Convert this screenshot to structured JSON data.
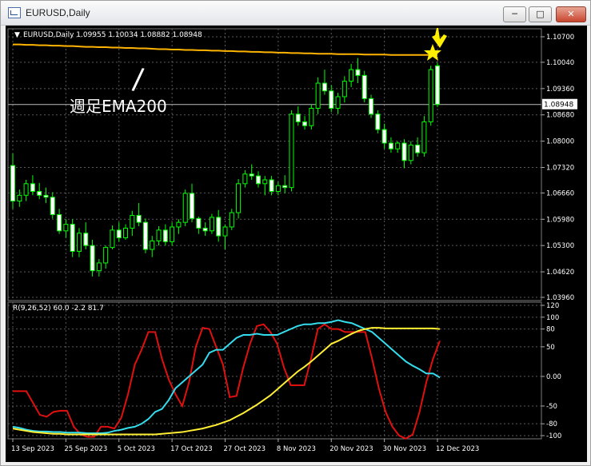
{
  "window": {
    "title": "EURUSD,Daily",
    "minimize_icon": "minimize-icon",
    "maximize_icon": "maximize-icon",
    "close_icon": "close-icon"
  },
  "colors": {
    "background": "#000000",
    "grid": "#5a5a5a",
    "candle_up": "#00ff00",
    "candle_down_body": "#ffffff",
    "ema": "#ffb400",
    "macd": "#e01010",
    "signal_cyan": "#33ddee",
    "signal_yellow": "#ffee33",
    "marker": "#ffee00",
    "annotation": "#ffffff"
  },
  "chart_data": [
    {
      "type": "candlestick",
      "title": "EURUSD,Daily  1.09955 1.10034 1.08882 1.08948",
      "symbol": "EURUSD",
      "timeframe": "Daily",
      "last_bar": {
        "open": 1.09955,
        "high": 1.10034,
        "low": 1.08882,
        "close": 1.08948
      },
      "current_price_label": "1.08948",
      "ylim": [
        1.0396,
        1.107
      ],
      "y_ticks": [
        "1.10700",
        "1.10040",
        "1.09360",
        "1.08680",
        "1.08000",
        "1.07320",
        "1.06660",
        "1.05980",
        "1.05300",
        "1.04620",
        "1.03960"
      ],
      "x_ticks": [
        "13 Sep 2023",
        "25 Sep 2023",
        "5 Oct 2023",
        "17 Oct 2023",
        "27 Oct 2023",
        "8 Nov 2023",
        "20 Nov 2023",
        "30 Nov 2023",
        "12 Dec 2023"
      ],
      "candles": [
        [
          1.0737,
          1.0768,
          1.0625,
          1.0645
        ],
        [
          1.0645,
          1.0675,
          1.063,
          1.066
        ],
        [
          1.066,
          1.07,
          1.0645,
          1.069
        ],
        [
          1.069,
          1.0712,
          1.066,
          1.067
        ],
        [
          1.067,
          1.0692,
          1.065,
          1.066
        ],
        [
          1.066,
          1.068,
          1.064,
          1.0655
        ],
        [
          1.0655,
          1.0668,
          1.06,
          1.061
        ],
        [
          1.061,
          1.0625,
          1.056,
          1.0568
        ],
        [
          1.0568,
          1.0598,
          1.055,
          1.0585
        ],
        [
          1.0585,
          1.0598,
          1.05,
          1.0515
        ],
        [
          1.0515,
          1.0575,
          1.05,
          1.0562
        ],
        [
          1.0562,
          1.059,
          1.052,
          1.053
        ],
        [
          1.053,
          1.0545,
          1.045,
          1.0465
        ],
        [
          1.0465,
          1.0495,
          1.045,
          1.0485
        ],
        [
          1.0485,
          1.053,
          1.047,
          1.0525
        ],
        [
          1.0525,
          1.0582,
          1.052,
          1.057
        ],
        [
          1.057,
          1.059,
          1.054,
          1.055
        ],
        [
          1.055,
          1.0585,
          1.0545,
          1.0575
        ],
        [
          1.0575,
          1.062,
          1.0555,
          1.0608
        ],
        [
          1.0608,
          1.064,
          1.058,
          1.059
        ],
        [
          1.059,
          1.06,
          1.051,
          1.052
        ],
        [
          1.052,
          1.0555,
          1.05,
          1.0542
        ],
        [
          1.0542,
          1.058,
          1.053,
          1.057
        ],
        [
          1.057,
          1.0585,
          1.053,
          1.054
        ],
        [
          1.054,
          1.059,
          1.053,
          1.0578
        ],
        [
          1.0578,
          1.0598,
          1.056,
          1.059
        ],
        [
          1.059,
          1.0675,
          1.058,
          1.0665
        ],
        [
          1.0665,
          1.069,
          1.059,
          1.06
        ],
        [
          1.06,
          1.0605,
          1.056,
          1.0575
        ],
        [
          1.0575,
          1.059,
          1.0555,
          1.0568
        ],
        [
          1.0568,
          1.0612,
          1.056,
          1.0603
        ],
        [
          1.0603,
          1.0622,
          1.054,
          1.0555
        ],
        [
          1.0555,
          1.0585,
          1.052,
          1.0578
        ],
        [
          1.0578,
          1.0625,
          1.057,
          1.0615
        ],
        [
          1.0615,
          1.0702,
          1.06,
          1.069
        ],
        [
          1.069,
          1.0725,
          1.068,
          1.0715
        ],
        [
          1.0715,
          1.074,
          1.07,
          1.071
        ],
        [
          1.071,
          1.0722,
          1.068,
          1.069
        ],
        [
          1.069,
          1.071,
          1.066,
          1.07
        ],
        [
          1.07,
          1.071,
          1.066,
          1.067
        ],
        [
          1.067,
          1.0695,
          1.066,
          1.0685
        ],
        [
          1.0685,
          1.0712,
          1.0665,
          1.068
        ],
        [
          1.068,
          1.088,
          1.067,
          1.087
        ],
        [
          1.087,
          1.089,
          1.084,
          1.085
        ],
        [
          1.085,
          1.0865,
          1.083,
          1.084
        ],
        [
          1.084,
          1.0895,
          1.083,
          1.0885
        ],
        [
          1.0885,
          1.0965,
          1.087,
          1.095
        ],
        [
          1.095,
          1.0985,
          1.092,
          1.093
        ],
        [
          1.093,
          1.0945,
          1.0875,
          1.0885
        ],
        [
          1.0885,
          1.0925,
          1.087,
          1.0915
        ],
        [
          1.0915,
          1.0968,
          1.09,
          1.0955
        ],
        [
          1.0955,
          1.1,
          1.094,
          1.0985
        ],
        [
          1.0985,
          1.1015,
          1.095,
          1.097
        ],
        [
          1.097,
          1.0982,
          1.09,
          1.091
        ],
        [
          1.091,
          1.092,
          1.086,
          1.087
        ],
        [
          1.087,
          1.088,
          1.082,
          1.083
        ],
        [
          1.083,
          1.0845,
          1.078,
          1.0795
        ],
        [
          1.0795,
          1.081,
          1.077,
          1.078
        ],
        [
          1.078,
          1.08,
          1.077,
          1.0795
        ],
        [
          1.0795,
          1.0805,
          1.073,
          1.075
        ],
        [
          1.075,
          1.08,
          1.074,
          1.079
        ],
        [
          1.079,
          1.081,
          1.076,
          1.077
        ],
        [
          1.077,
          1.0865,
          1.076,
          1.085
        ],
        [
          1.085,
          1.0995,
          1.084,
          1.0985
        ],
        [
          1.0995,
          1.1003,
          1.0888,
          1.0895
        ]
      ],
      "series": [
        {
          "name": "週足EMA200",
          "values": [
            1.105,
            1.105,
            1.1049,
            1.1049,
            1.1048,
            1.1048,
            1.1047,
            1.1047,
            1.1046,
            1.1046,
            1.1045,
            1.1044,
            1.1044,
            1.1043,
            1.1043,
            1.1042,
            1.1042,
            1.1041,
            1.1041,
            1.104,
            1.104,
            1.1039,
            1.1038,
            1.1038,
            1.1037,
            1.1037,
            1.1036,
            1.1036,
            1.1035,
            1.1035,
            1.1034,
            1.1034,
            1.1033,
            1.1033,
            1.1032,
            1.1032,
            1.1031,
            1.1031,
            1.103,
            1.103,
            1.1029,
            1.1029,
            1.1028,
            1.1028,
            1.1027,
            1.1027,
            1.1026,
            1.1026,
            1.1026,
            1.1025,
            1.1025,
            1.1025,
            1.1025,
            1.1024,
            1.1024,
            1.1024,
            1.1024,
            1.1023,
            1.1023,
            1.1023,
            1.1023,
            1.1023,
            1.1023,
            1.1023,
            1.1023
          ]
        }
      ],
      "annotation": {
        "text": "週足EMA200",
        "stroke_char": "/"
      }
    },
    {
      "type": "line",
      "title": "R(9,26,52) 60.0 -2.2 81.7",
      "ylim": [
        -100,
        120
      ],
      "y_ticks": [
        "120",
        "100",
        "80",
        "50",
        "0.00",
        "-50",
        "-80",
        "-100"
      ],
      "series": [
        {
          "name": "",
          "values": [
            -25,
            -25,
            -25,
            -45,
            -65,
            -68,
            -60,
            -58,
            -58,
            -85,
            -98,
            -102,
            -102,
            -85,
            -85,
            -88,
            -70,
            -30,
            20,
            45,
            75,
            75,
            30,
            -5,
            -30,
            -50,
            -10,
            50,
            82,
            80,
            50,
            20,
            -35,
            -33,
            15,
            55,
            85,
            88,
            75,
            55,
            15,
            -15,
            -15,
            -15,
            30,
            80,
            88,
            80,
            80,
            75,
            75,
            75,
            75,
            30,
            -20,
            -60,
            -85,
            -100,
            -105,
            -98,
            -60,
            -10,
            30,
            60
          ]
        },
        {
          "name": "",
          "values": [
            -85,
            -87,
            -90,
            -92,
            -93,
            -93,
            -94,
            -94,
            -95,
            -95,
            -95,
            -96,
            -96,
            -96,
            -95,
            -92,
            -90,
            -87,
            -85,
            -80,
            -72,
            -60,
            -55,
            -40,
            -20,
            -10,
            0,
            10,
            20,
            40,
            45,
            45,
            55,
            65,
            70,
            70,
            72,
            70,
            70,
            70,
            75,
            80,
            85,
            88,
            88,
            90,
            90,
            92,
            95,
            92,
            90,
            85,
            80,
            75,
            65,
            55,
            45,
            35,
            25,
            18,
            12,
            5,
            5,
            -2
          ]
        },
        {
          "name": "",
          "values": [
            -88,
            -90,
            -92,
            -94,
            -95,
            -96,
            -97,
            -97,
            -98,
            -98,
            -98,
            -98,
            -98,
            -98,
            -98,
            -98,
            -98,
            -98,
            -98,
            -98,
            -98,
            -98,
            -97,
            -96,
            -95,
            -94,
            -92,
            -90,
            -88,
            -85,
            -82,
            -78,
            -74,
            -68,
            -62,
            -55,
            -48,
            -40,
            -32,
            -22,
            -12,
            -2,
            8,
            16,
            25,
            35,
            45,
            55,
            60,
            66,
            72,
            77,
            80,
            82,
            82,
            81,
            81,
            81,
            81,
            81,
            81,
            81,
            81,
            80
          ]
        }
      ]
    }
  ]
}
